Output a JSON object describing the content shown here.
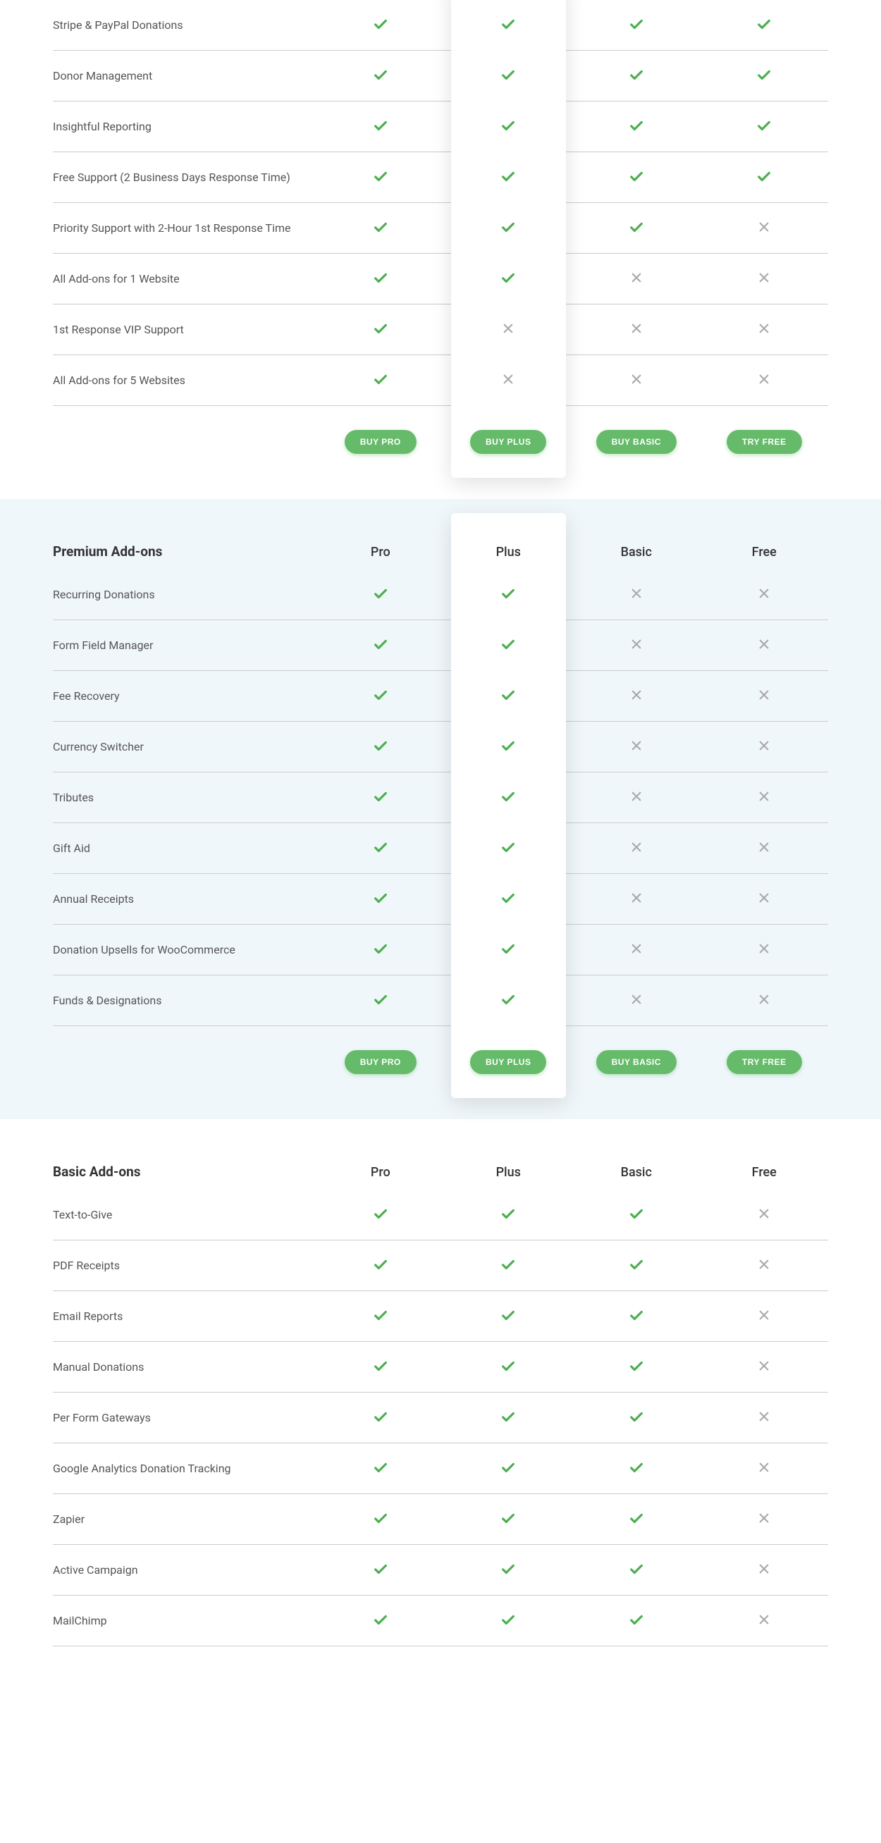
{
  "columns": [
    "Pro",
    "Plus",
    "Basic",
    "Free"
  ],
  "buttons": {
    "pro": "BUY PRO",
    "plus": "BUY PLUS",
    "basic": "BUY BASIC",
    "free": "TRY FREE"
  },
  "sections": [
    {
      "id": "core",
      "title": "",
      "alt": false,
      "showHeader": false,
      "highlight": true,
      "rows": [
        {
          "label": "Stripe & PayPal Donations",
          "vals": [
            "check",
            "check",
            "check",
            "check"
          ]
        },
        {
          "label": "Donor Management",
          "vals": [
            "check",
            "check",
            "check",
            "check"
          ]
        },
        {
          "label": "Insightful Reporting",
          "vals": [
            "check",
            "check",
            "check",
            "check"
          ]
        },
        {
          "label": "Free Support (2 Business Days Response Time)",
          "vals": [
            "check",
            "check",
            "check",
            "check"
          ]
        },
        {
          "label": "Priority Support with 2-Hour 1st Response Time",
          "vals": [
            "check",
            "check",
            "check",
            "cross"
          ]
        },
        {
          "label": "All Add-ons for 1 Website",
          "vals": [
            "check",
            "check",
            "cross",
            "cross"
          ]
        },
        {
          "label": "1st Response VIP Support",
          "vals": [
            "check",
            "cross",
            "cross",
            "cross"
          ]
        },
        {
          "label": "All Add-ons for 5 Websites",
          "vals": [
            "check",
            "cross",
            "cross",
            "cross"
          ]
        }
      ]
    },
    {
      "id": "premium",
      "title": "Premium Add-ons",
      "alt": true,
      "showHeader": true,
      "highlight": true,
      "rows": [
        {
          "label": "Recurring Donations",
          "vals": [
            "check",
            "check",
            "cross",
            "cross"
          ]
        },
        {
          "label": "Form Field Manager",
          "vals": [
            "check",
            "check",
            "cross",
            "cross"
          ]
        },
        {
          "label": "Fee Recovery",
          "vals": [
            "check",
            "check",
            "cross",
            "cross"
          ]
        },
        {
          "label": "Currency Switcher",
          "vals": [
            "check",
            "check",
            "cross",
            "cross"
          ]
        },
        {
          "label": "Tributes",
          "vals": [
            "check",
            "check",
            "cross",
            "cross"
          ]
        },
        {
          "label": "Gift Aid",
          "vals": [
            "check",
            "check",
            "cross",
            "cross"
          ]
        },
        {
          "label": "Annual Receipts",
          "vals": [
            "check",
            "check",
            "cross",
            "cross"
          ]
        },
        {
          "label": "Donation Upsells for WooCommerce",
          "vals": [
            "check",
            "check",
            "cross",
            "cross"
          ]
        },
        {
          "label": "Funds & Designations",
          "vals": [
            "check",
            "check",
            "cross",
            "cross"
          ]
        }
      ]
    },
    {
      "id": "basic",
      "title": "Basic Add-ons",
      "alt": false,
      "showHeader": true,
      "highlight": false,
      "showButtons": false,
      "rows": [
        {
          "label": "Text-to-Give",
          "vals": [
            "check",
            "check",
            "check",
            "cross"
          ]
        },
        {
          "label": "PDF Receipts",
          "vals": [
            "check",
            "check",
            "check",
            "cross"
          ]
        },
        {
          "label": "Email Reports",
          "vals": [
            "check",
            "check",
            "check",
            "cross"
          ]
        },
        {
          "label": "Manual Donations",
          "vals": [
            "check",
            "check",
            "check",
            "cross"
          ]
        },
        {
          "label": "Per Form Gateways",
          "vals": [
            "check",
            "check",
            "check",
            "cross"
          ]
        },
        {
          "label": "Google Analytics Donation Tracking",
          "vals": [
            "check",
            "check",
            "check",
            "cross"
          ]
        },
        {
          "label": "Zapier",
          "vals": [
            "check",
            "check",
            "check",
            "cross"
          ]
        },
        {
          "label": "Active Campaign",
          "vals": [
            "check",
            "check",
            "check",
            "cross"
          ]
        },
        {
          "label": "MailChimp",
          "vals": [
            "check",
            "check",
            "check",
            "cross"
          ]
        }
      ]
    }
  ]
}
